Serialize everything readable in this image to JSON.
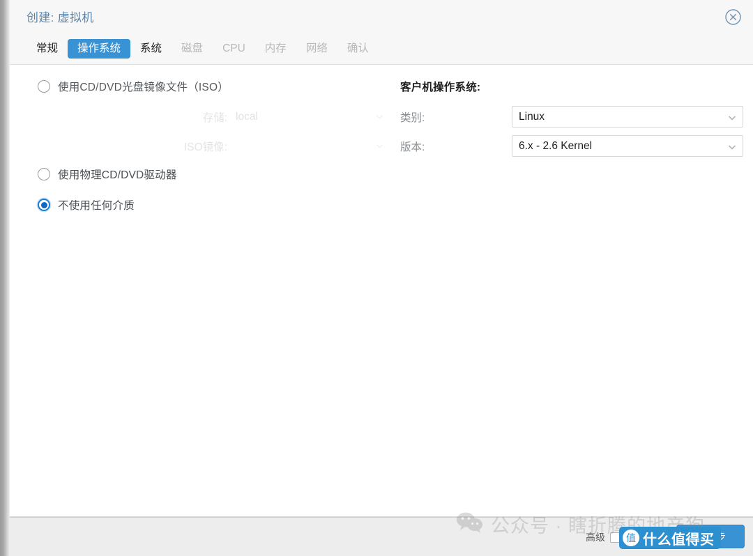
{
  "window": {
    "title": "创建: 虚拟机",
    "close_icon": "close-circle-icon"
  },
  "tabs": [
    {
      "label": "常规",
      "state": "enabled"
    },
    {
      "label": "操作系统",
      "state": "active"
    },
    {
      "label": "系统",
      "state": "enabled"
    },
    {
      "label": "磁盘",
      "state": "disabled"
    },
    {
      "label": "CPU",
      "state": "disabled"
    },
    {
      "label": "内存",
      "state": "disabled"
    },
    {
      "label": "网络",
      "state": "disabled"
    },
    {
      "label": "确认",
      "state": "disabled"
    }
  ],
  "media": {
    "options": [
      {
        "label": "使用CD/DVD光盘镜像文件（ISO）",
        "selected": false
      },
      {
        "label": "使用物理CD/DVD驱动器",
        "selected": false
      },
      {
        "label": "不使用任何介质",
        "selected": true
      }
    ],
    "iso_fields": [
      {
        "label": "存储:",
        "value": "local",
        "caret_icon": "chevron-down-icon"
      },
      {
        "label": "ISO镜像:",
        "value": "",
        "caret_icon": "chevron-down-icon"
      }
    ]
  },
  "guest_os": {
    "heading": "客户机操作系统:",
    "fields": [
      {
        "label": "类别:",
        "value": "Linux",
        "caret_icon": "chevron-down-icon"
      },
      {
        "label": "版本:",
        "value": "6.x - 2.6 Kernel",
        "caret_icon": "chevron-down-icon"
      }
    ]
  },
  "footer": {
    "advanced_label": "高级",
    "advanced_checked": false,
    "next_label": "下一步"
  },
  "watermarks": {
    "wechat_icon": "wechat-icon",
    "wechat_text": "公众号 · 瞎折腾的地产狗",
    "badge_mark": "值",
    "badge_text": "什么值得买"
  },
  "colors": {
    "accent": "#3892d4",
    "title": "#5a86ad",
    "header_bg": "#f7f7f7",
    "footer_bg": "#ededed",
    "radio_selected": "#1168c4",
    "disabled_text": "#b9b9b9"
  }
}
